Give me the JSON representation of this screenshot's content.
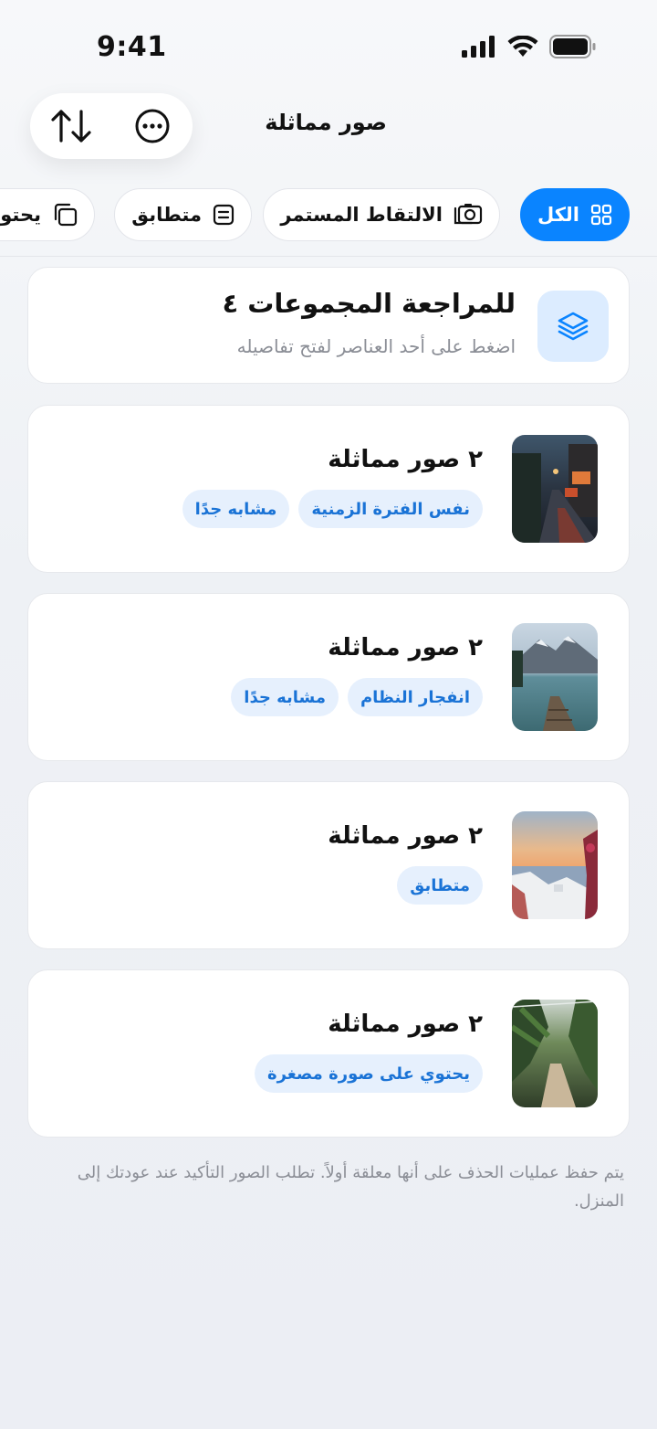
{
  "status_bar": {
    "time": "9:41"
  },
  "header": {
    "title": "صور مماثلة",
    "sort_icon": "arrows-up-down-icon",
    "more_icon": "ellipsis-circle-icon"
  },
  "filters": [
    {
      "label": "الكل",
      "icon": "grid-icon",
      "active": true
    },
    {
      "label": "الالتقاط المستمر",
      "icon": "camera-burst-icon",
      "active": false
    },
    {
      "label": "متطابق",
      "icon": "document-lines-icon",
      "active": false
    },
    {
      "label": "يحتوي",
      "icon": "copy-icon",
      "active": false
    }
  ],
  "summary": {
    "title": "للمراجعة المجموعات ٤",
    "subtitle": "اضغط على أحد العناصر لفتح تفاصيله",
    "icon": "layers-icon",
    "accent": "#0a84ff"
  },
  "groups": [
    {
      "title": "٢ صور مماثلة",
      "thumbnail": "rainy-street-photo",
      "tags": [
        "نفس الفترة الزمنية",
        "مشابه جدًا"
      ]
    },
    {
      "title": "٢ صور مماثلة",
      "thumbnail": "lake-mountain-pier-photo",
      "tags": [
        "انفجار النظام",
        "مشابه جدًا"
      ]
    },
    {
      "title": "٢ صور مماثلة",
      "thumbnail": "coastal-village-sunset-photo",
      "tags": [
        "متطابق"
      ]
    },
    {
      "title": "٢ صور مماثلة",
      "thumbnail": "greenhouse-path-photo",
      "tags": [
        "يحتوي على صورة مصغرة"
      ]
    }
  ],
  "footnote": "يتم حفظ عمليات الحذف على أنها معلقة أولاً. تطلب الصور التأكيد عند عودتك إلى المنزل."
}
